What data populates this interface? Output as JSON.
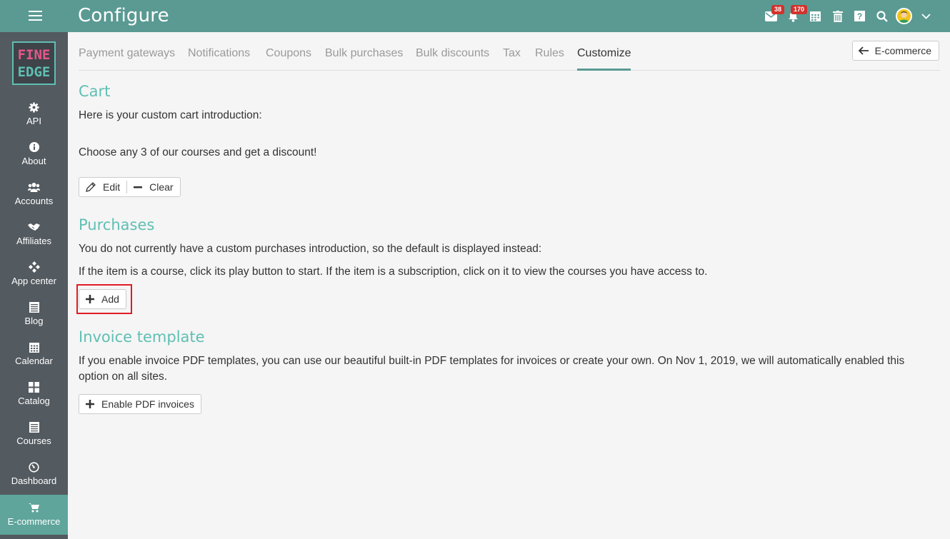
{
  "header": {
    "title": "Configure",
    "messages_badge": "38",
    "notifications_badge": "170"
  },
  "sidebar": {
    "logo_line1": "FINE",
    "logo_line2": "EDGE",
    "items": [
      {
        "label": "API",
        "icon": "gear-icon"
      },
      {
        "label": "About",
        "icon": "info-icon"
      },
      {
        "label": "Accounts",
        "icon": "users-icon"
      },
      {
        "label": "Affiliates",
        "icon": "handshake-icon"
      },
      {
        "label": "App center",
        "icon": "diamonds-icon"
      },
      {
        "label": "Blog",
        "icon": "blog-icon"
      },
      {
        "label": "Calendar",
        "icon": "calendar-icon"
      },
      {
        "label": "Catalog",
        "icon": "grid-icon"
      },
      {
        "label": "Courses",
        "icon": "courses-icon"
      },
      {
        "label": "Dashboard",
        "icon": "dashboard-icon"
      },
      {
        "label": "E-commerce",
        "icon": "cart-icon",
        "active": true
      }
    ]
  },
  "tabs": [
    {
      "label": "Payment gateways"
    },
    {
      "label": "Notifications"
    },
    {
      "label": "Coupons"
    },
    {
      "label": "Bulk purchases"
    },
    {
      "label": "Bulk discounts"
    },
    {
      "label": "Tax"
    },
    {
      "label": "Rules"
    },
    {
      "label": "Customize",
      "active": true
    }
  ],
  "back_button": {
    "label": "E-commerce"
  },
  "cart": {
    "title": "Cart",
    "intro": "Here is your custom cart introduction:",
    "text": "Choose any 3 of our courses and get a discount!",
    "edit_label": "Edit",
    "clear_label": "Clear"
  },
  "purchases": {
    "title": "Purchases",
    "line1": "You do not currently have a custom purchases introduction, so the default is displayed instead:",
    "line2": "If the item is a course, click its play button to start. If the item is a subscription, click on it to view the courses you have access to.",
    "add_label": "Add"
  },
  "invoice": {
    "title": "Invoice template",
    "line1": "If you enable invoice PDF templates, you can use our beautiful built-in PDF templates for invoices or create your own. On Nov 1, 2019, we will automatically enabled this",
    "line2": "option on all sites.",
    "enable_label": "Enable PDF invoices"
  },
  "colors": {
    "header": "#5a9a93",
    "sidebar": "#535a60",
    "active_nav": "#5fa59c",
    "section_title": "#5fbfb3",
    "highlight": "#e01c24"
  }
}
